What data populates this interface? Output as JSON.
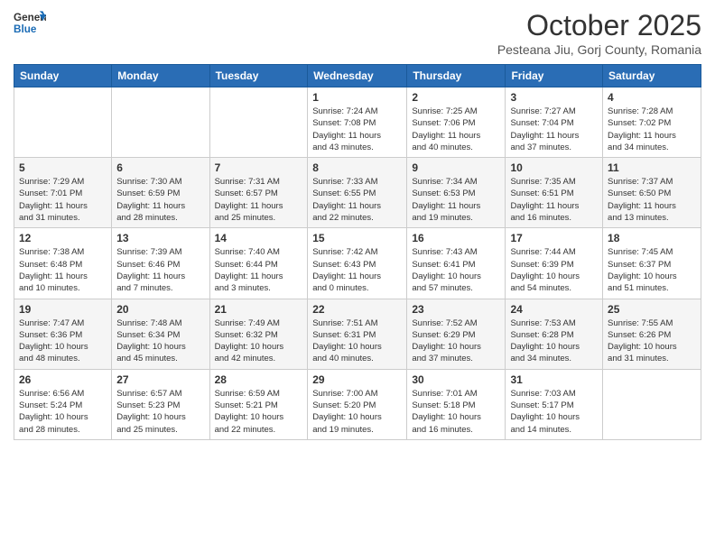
{
  "header": {
    "logo_general": "General",
    "logo_blue": "Blue",
    "month_title": "October 2025",
    "subtitle": "Pesteana Jiu, Gorj County, Romania"
  },
  "weekdays": [
    "Sunday",
    "Monday",
    "Tuesday",
    "Wednesday",
    "Thursday",
    "Friday",
    "Saturday"
  ],
  "weeks": [
    [
      {
        "day": "",
        "info": ""
      },
      {
        "day": "",
        "info": ""
      },
      {
        "day": "",
        "info": ""
      },
      {
        "day": "1",
        "info": "Sunrise: 7:24 AM\nSunset: 7:08 PM\nDaylight: 11 hours\nand 43 minutes."
      },
      {
        "day": "2",
        "info": "Sunrise: 7:25 AM\nSunset: 7:06 PM\nDaylight: 11 hours\nand 40 minutes."
      },
      {
        "day": "3",
        "info": "Sunrise: 7:27 AM\nSunset: 7:04 PM\nDaylight: 11 hours\nand 37 minutes."
      },
      {
        "day": "4",
        "info": "Sunrise: 7:28 AM\nSunset: 7:02 PM\nDaylight: 11 hours\nand 34 minutes."
      }
    ],
    [
      {
        "day": "5",
        "info": "Sunrise: 7:29 AM\nSunset: 7:01 PM\nDaylight: 11 hours\nand 31 minutes."
      },
      {
        "day": "6",
        "info": "Sunrise: 7:30 AM\nSunset: 6:59 PM\nDaylight: 11 hours\nand 28 minutes."
      },
      {
        "day": "7",
        "info": "Sunrise: 7:31 AM\nSunset: 6:57 PM\nDaylight: 11 hours\nand 25 minutes."
      },
      {
        "day": "8",
        "info": "Sunrise: 7:33 AM\nSunset: 6:55 PM\nDaylight: 11 hours\nand 22 minutes."
      },
      {
        "day": "9",
        "info": "Sunrise: 7:34 AM\nSunset: 6:53 PM\nDaylight: 11 hours\nand 19 minutes."
      },
      {
        "day": "10",
        "info": "Sunrise: 7:35 AM\nSunset: 6:51 PM\nDaylight: 11 hours\nand 16 minutes."
      },
      {
        "day": "11",
        "info": "Sunrise: 7:37 AM\nSunset: 6:50 PM\nDaylight: 11 hours\nand 13 minutes."
      }
    ],
    [
      {
        "day": "12",
        "info": "Sunrise: 7:38 AM\nSunset: 6:48 PM\nDaylight: 11 hours\nand 10 minutes."
      },
      {
        "day": "13",
        "info": "Sunrise: 7:39 AM\nSunset: 6:46 PM\nDaylight: 11 hours\nand 7 minutes."
      },
      {
        "day": "14",
        "info": "Sunrise: 7:40 AM\nSunset: 6:44 PM\nDaylight: 11 hours\nand 3 minutes."
      },
      {
        "day": "15",
        "info": "Sunrise: 7:42 AM\nSunset: 6:43 PM\nDaylight: 11 hours\nand 0 minutes."
      },
      {
        "day": "16",
        "info": "Sunrise: 7:43 AM\nSunset: 6:41 PM\nDaylight: 10 hours\nand 57 minutes."
      },
      {
        "day": "17",
        "info": "Sunrise: 7:44 AM\nSunset: 6:39 PM\nDaylight: 10 hours\nand 54 minutes."
      },
      {
        "day": "18",
        "info": "Sunrise: 7:45 AM\nSunset: 6:37 PM\nDaylight: 10 hours\nand 51 minutes."
      }
    ],
    [
      {
        "day": "19",
        "info": "Sunrise: 7:47 AM\nSunset: 6:36 PM\nDaylight: 10 hours\nand 48 minutes."
      },
      {
        "day": "20",
        "info": "Sunrise: 7:48 AM\nSunset: 6:34 PM\nDaylight: 10 hours\nand 45 minutes."
      },
      {
        "day": "21",
        "info": "Sunrise: 7:49 AM\nSunset: 6:32 PM\nDaylight: 10 hours\nand 42 minutes."
      },
      {
        "day": "22",
        "info": "Sunrise: 7:51 AM\nSunset: 6:31 PM\nDaylight: 10 hours\nand 40 minutes."
      },
      {
        "day": "23",
        "info": "Sunrise: 7:52 AM\nSunset: 6:29 PM\nDaylight: 10 hours\nand 37 minutes."
      },
      {
        "day": "24",
        "info": "Sunrise: 7:53 AM\nSunset: 6:28 PM\nDaylight: 10 hours\nand 34 minutes."
      },
      {
        "day": "25",
        "info": "Sunrise: 7:55 AM\nSunset: 6:26 PM\nDaylight: 10 hours\nand 31 minutes."
      }
    ],
    [
      {
        "day": "26",
        "info": "Sunrise: 6:56 AM\nSunset: 5:24 PM\nDaylight: 10 hours\nand 28 minutes."
      },
      {
        "day": "27",
        "info": "Sunrise: 6:57 AM\nSunset: 5:23 PM\nDaylight: 10 hours\nand 25 minutes."
      },
      {
        "day": "28",
        "info": "Sunrise: 6:59 AM\nSunset: 5:21 PM\nDaylight: 10 hours\nand 22 minutes."
      },
      {
        "day": "29",
        "info": "Sunrise: 7:00 AM\nSunset: 5:20 PM\nDaylight: 10 hours\nand 19 minutes."
      },
      {
        "day": "30",
        "info": "Sunrise: 7:01 AM\nSunset: 5:18 PM\nDaylight: 10 hours\nand 16 minutes."
      },
      {
        "day": "31",
        "info": "Sunrise: 7:03 AM\nSunset: 5:17 PM\nDaylight: 10 hours\nand 14 minutes."
      },
      {
        "day": "",
        "info": ""
      }
    ]
  ]
}
